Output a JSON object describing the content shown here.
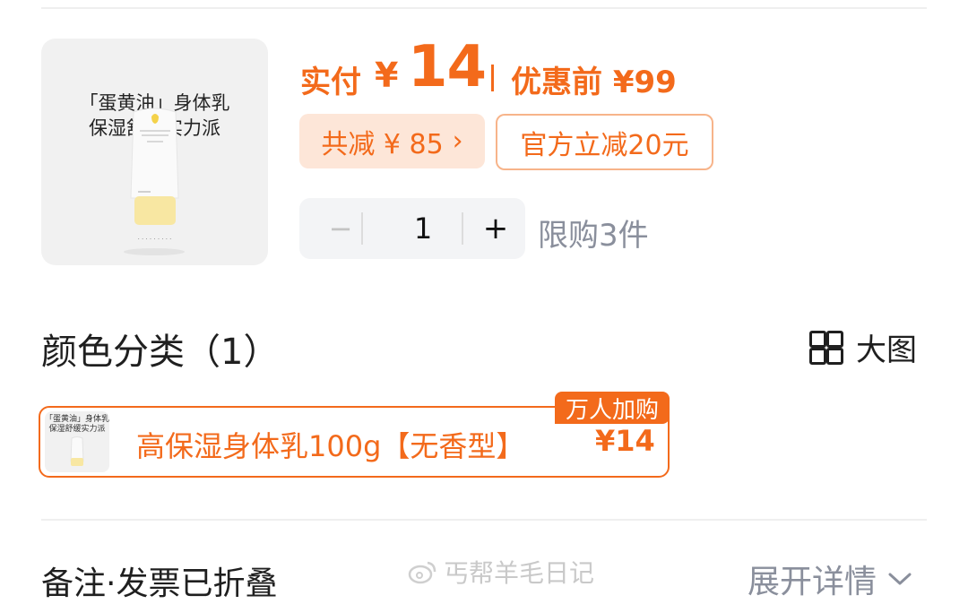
{
  "product": {
    "image_caption_line1": "「蛋黄油」身体乳",
    "image_caption_line2": "保湿舒缓实力派"
  },
  "price": {
    "pay_label": "实付",
    "currency": "¥",
    "pay_amount": "14",
    "original_label": "优惠前 ¥99"
  },
  "discounts": {
    "total_label": "共减 ¥ 85",
    "total_chevron": "›",
    "official_label": "官方立减20元"
  },
  "quantity": {
    "minus": "−",
    "value": "1",
    "plus": "+",
    "limit": "限购3件"
  },
  "color_section": {
    "title": "颜色分类（1）",
    "big_view_label": "大图"
  },
  "sku": {
    "badge": "万人加购",
    "name": "高保湿身体乳100g【无香型】",
    "price": "¥14",
    "thumb_caption": "「蛋黄油」身体乳\n保湿舒缓实力派"
  },
  "footer": {
    "note_label": "备注·发票已折叠",
    "watermark": "丐帮羊毛日记",
    "expand_label": "展开详情"
  },
  "colors": {
    "accent": "#f36a1b",
    "accent_soft": "#fde6d8",
    "muted": "#8a8f9c"
  }
}
